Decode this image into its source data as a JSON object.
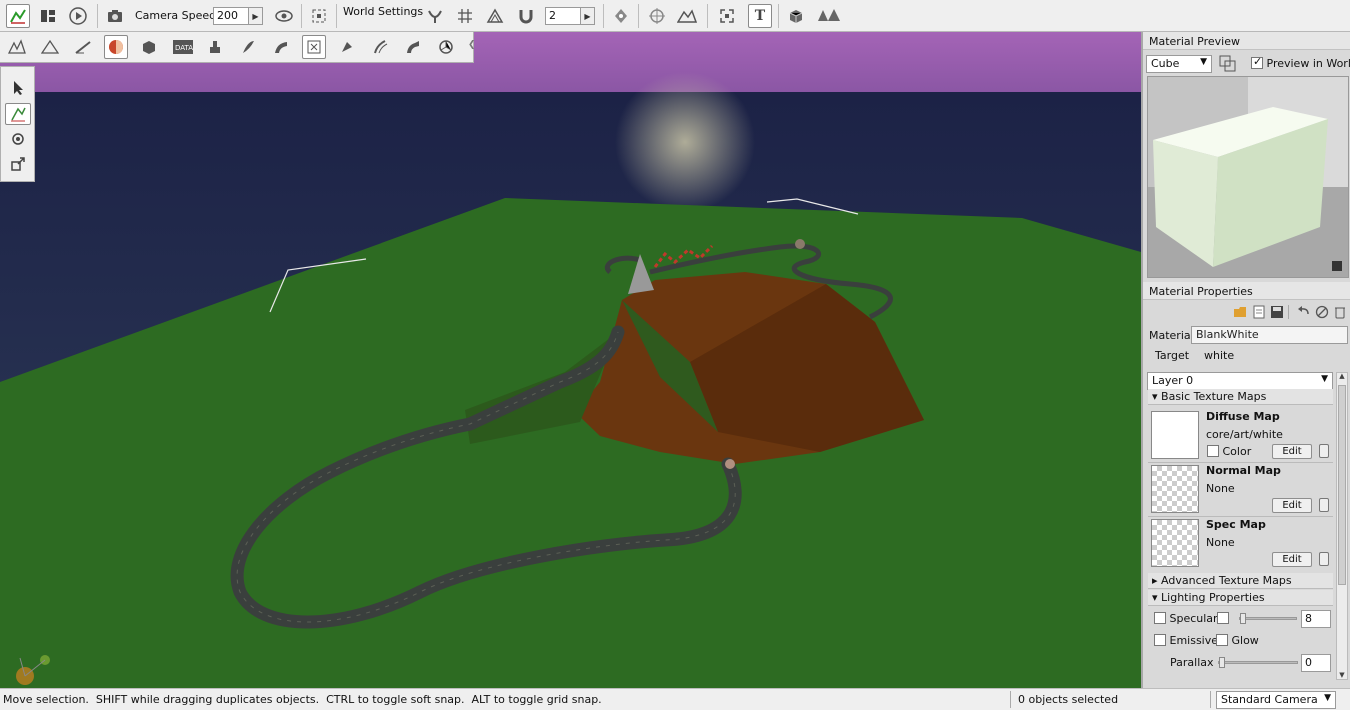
{
  "toolbar": {
    "camera_speed_label": "Camera Speed",
    "camera_speed_value": "200",
    "world_settings_label": "World Settings",
    "grid_size_value": "2"
  },
  "material_preview": {
    "title": "Material Preview",
    "shape_select": "Cube",
    "preview_in_world_label": "Preview in World",
    "preview_in_world_checked": true
  },
  "material_properties": {
    "title": "Material Properties",
    "material_label": "Material",
    "material_value": "BlankWhite",
    "target_label": "Target",
    "target_value": "white",
    "layer_select": "Layer 0",
    "basic_texture_maps": "Basic Texture Maps",
    "diffuse": {
      "title": "Diffuse Map",
      "path": "core/art/white",
      "color_label": "Color",
      "edit": "Edit"
    },
    "normal": {
      "title": "Normal Map",
      "path": "None",
      "edit": "Edit"
    },
    "spec": {
      "title": "Spec Map",
      "path": "None",
      "edit": "Edit"
    },
    "advanced_texture_maps": "Advanced Texture Maps",
    "lighting_properties": "Lighting Properties",
    "specular_label": "Specular",
    "specular_value": "8",
    "emissive_label": "Emissive",
    "glow_label": "Glow",
    "parallax_label": "Parallax",
    "parallax_value": "0"
  },
  "status": {
    "hint": "Move selection.  SHIFT while dragging duplicates objects.  CTRL to toggle soft snap.  ALT to toggle grid snap.",
    "selection": "0 objects selected",
    "camera_select": "Standard Camera"
  },
  "colors": {
    "sky_top": "#9b5fae",
    "sea": "#1a2240",
    "ground": "#2c6a22",
    "hill": "#6b3610",
    "track": "#3a3f3d"
  }
}
